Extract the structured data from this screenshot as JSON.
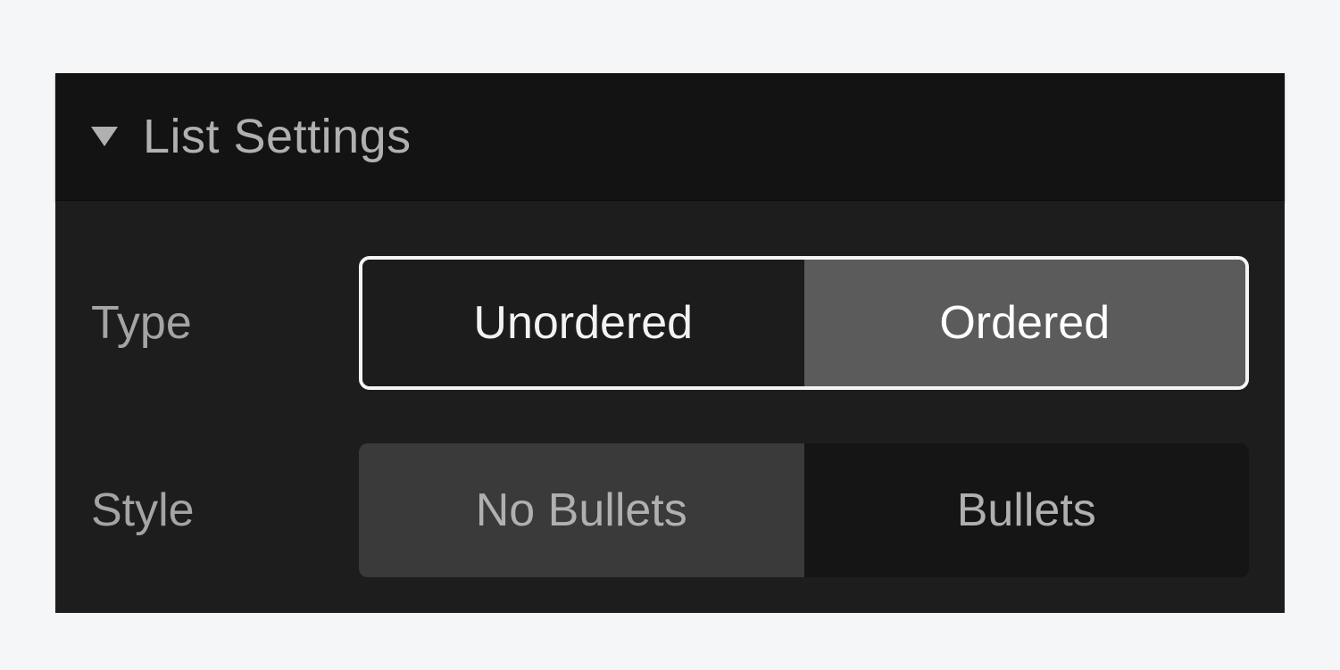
{
  "panel": {
    "title": "List Settings",
    "rows": {
      "type": {
        "label": "Type",
        "options": [
          "Unordered",
          "Ordered"
        ],
        "active_index": 1
      },
      "style": {
        "label": "Style",
        "options": [
          "No Bullets",
          "Bullets"
        ],
        "active_index": 0
      }
    }
  },
  "colors": {
    "page_bg": "#f5f6f8",
    "panel_header_bg": "#131313",
    "panel_body_bg": "#1d1d1d",
    "segment_active_bg": "#5b5b5b",
    "segment_muted_bg": "#3a3a3a",
    "segment_dark_bg": "#151515",
    "text_primary": "#f2f2f2",
    "text_secondary": "#b0b0b0",
    "outline": "#f4f4f4"
  }
}
